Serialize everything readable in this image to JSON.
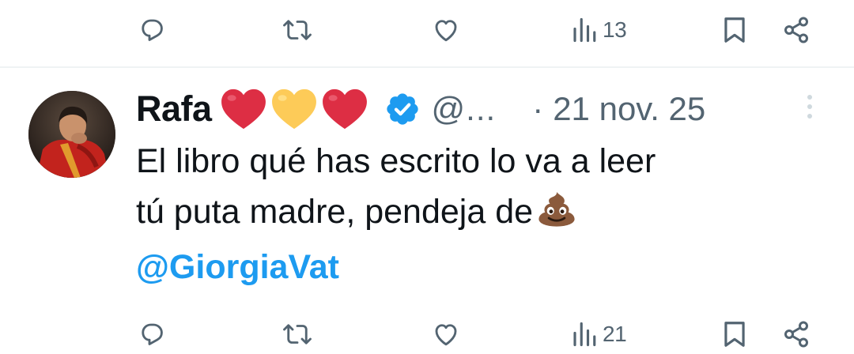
{
  "previous_tweet_actions": {
    "views_count": "13"
  },
  "tweet": {
    "author_name": "Rafa",
    "handle": "@...",
    "separator": "·",
    "date": "21 nov. 25",
    "text_line1": "El libro qué has escrito lo va a leer",
    "text_line2": "tú puta madre, pendeja de",
    "mention": "@GiorgiaVat",
    "actions": {
      "views_count": "21"
    }
  },
  "colors": {
    "accent": "#1d9bf0",
    "secondary_text": "#536471",
    "primary_text": "#0f1419",
    "divider": "#eff3f4"
  },
  "icons": [
    "reply-icon",
    "retweet-icon",
    "like-icon",
    "views-icon",
    "bookmark-icon",
    "share-icon",
    "verified-badge-icon",
    "red-heart-emoji",
    "yellow-heart-emoji",
    "poop-emoji",
    "more-options-icon"
  ]
}
